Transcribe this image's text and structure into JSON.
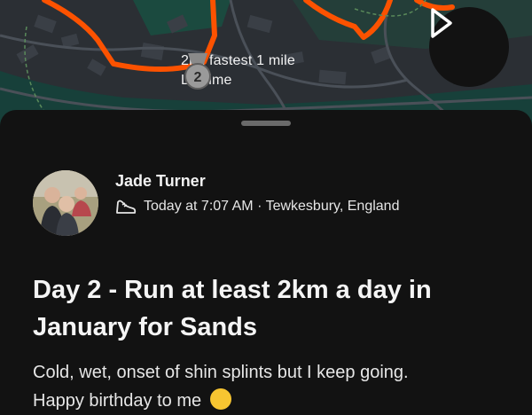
{
  "map": {
    "achievement": {
      "rank_number": "2",
      "title": "2nd fastest 1 mile",
      "subtitle": "Lifetime"
    },
    "route_color": "#fc5200",
    "play_icon": "play-icon"
  },
  "activity": {
    "athlete_name": "Jade Turner",
    "sport_icon": "running-shoe-icon",
    "meta": "Today at 7:07 AM · Tewkesbury, England",
    "title": "Day 2 - Run at least 2km a day in January for Sands",
    "description_line1": "Cold, wet, onset of shin splints but I keep going.",
    "description_line2": "Happy birthday to me",
    "emoji": "face-with-tears-of-joy-emoji"
  }
}
